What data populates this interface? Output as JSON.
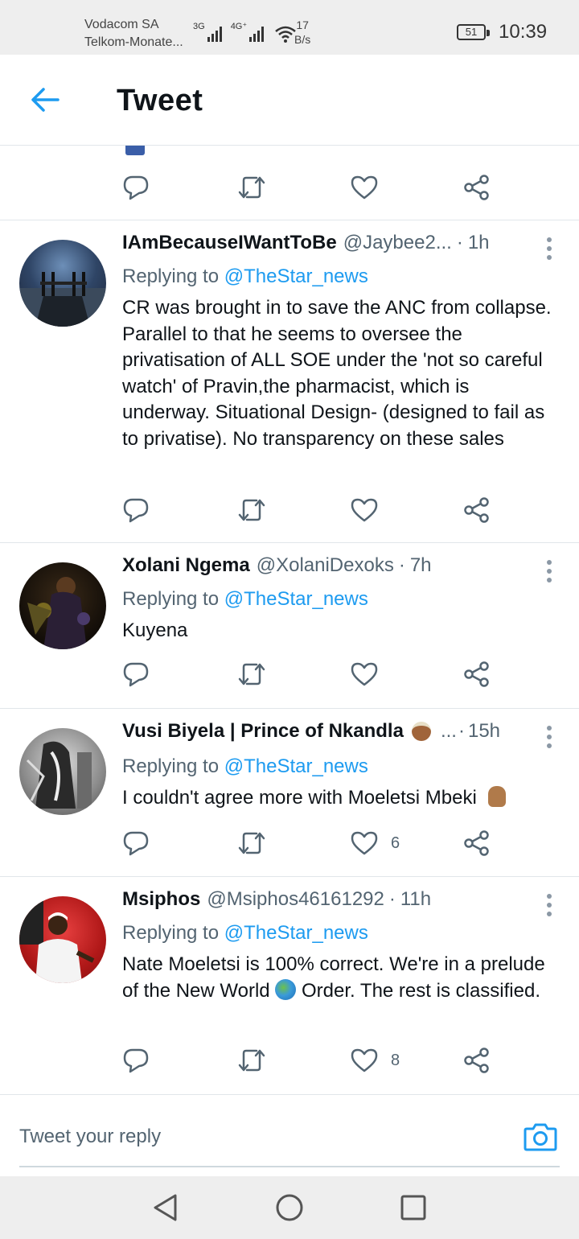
{
  "status_bar": {
    "carrier1": "Vodacom SA",
    "carrier2": "Telkom-Monate...",
    "net1": "3G",
    "net2": "4G⁺",
    "speed_value": "17",
    "speed_unit": "B/s",
    "battery": "51",
    "time": "10:39"
  },
  "header": {
    "title": "Tweet"
  },
  "tweets": [
    {
      "name": "IAmBecauseIWantToBe",
      "handle": "@Jaybee2...",
      "time": "1h",
      "replying_prefix": "Replying to",
      "replying_to": "@TheStar_news",
      "text": "CR was brought in to save the ANC from collapse. Parallel to that he  seems to oversee the privatisation of ALL SOE under the 'not so careful watch' of Pravin,the pharmacist, which is underway. Situational Design- (designed to fail as to privatise). No transparency on these sales",
      "likes": ""
    },
    {
      "name": "Xolani Ngema",
      "handle": "@XolaniDexoks",
      "time": "7h",
      "replying_prefix": "Replying to",
      "replying_to": "@TheStar_news",
      "text": "Kuyena",
      "likes": ""
    },
    {
      "name": "Vusi Biyela | Prince of Nkandla",
      "handle": "...",
      "time": "15h",
      "replying_prefix": "Replying to",
      "replying_to": "@TheStar_news",
      "text": "I couldn't agree more with Moeletsi Mbeki",
      "likes": "6"
    },
    {
      "name": "Msiphos",
      "handle": "@Msiphos46161292",
      "time": "11h",
      "replying_prefix": "Replying to",
      "replying_to": "@TheStar_news",
      "text_before": "Nate Moeletsi is 100% correct. We're in a prelude of the New World",
      "text_after": "Order. The rest is classified.",
      "likes": "8"
    }
  ],
  "reply_bar": {
    "placeholder": "Tweet your reply"
  },
  "icons": {
    "accent": "#1d9bf0",
    "action_color": "#536471"
  }
}
